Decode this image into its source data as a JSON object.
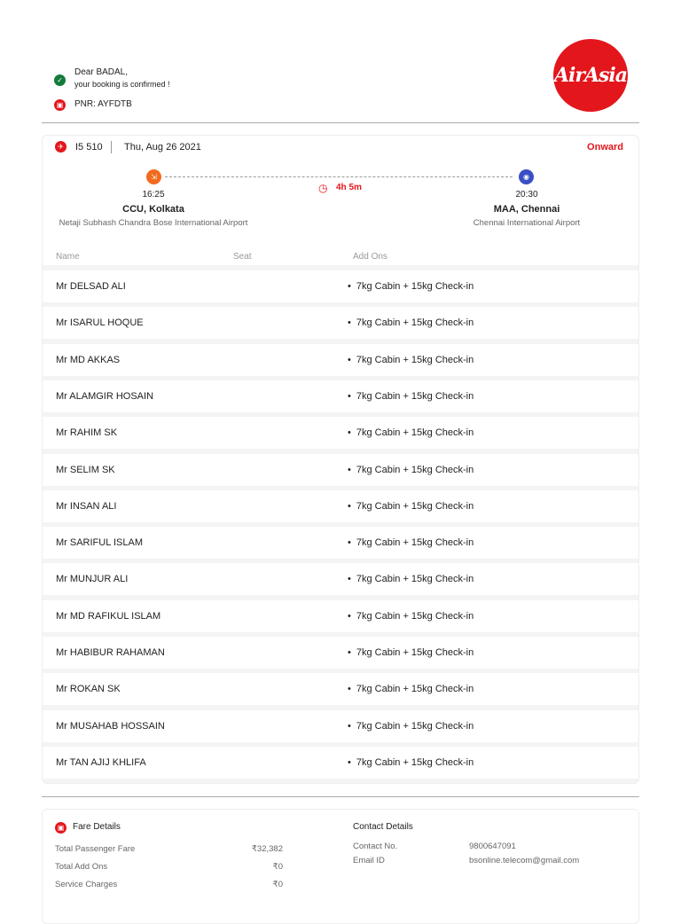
{
  "greeting": {
    "line1": "Dear BADAL,",
    "line2": "your booking is confirmed !",
    "pnr": "PNR: AYFDTB"
  },
  "logo": "AirAsia",
  "flight": {
    "number": "I5 510",
    "date": "Thu, Aug 26 2021",
    "direction": "Onward",
    "duration": "4h 5m",
    "origin": {
      "time": "16:25",
      "code": "CCU, Kolkata",
      "airport": "Netaji Subhash Chandra Bose International Airport"
    },
    "destination": {
      "time": "20:30",
      "code": "MAA, Chennai",
      "airport": "Chennai International Airport"
    }
  },
  "table": {
    "headers": [
      "Name",
      "Seat",
      "Add Ons"
    ],
    "rows": [
      {
        "name": "Mr DELSAD ALI",
        "addon": "7kg Cabin + 15kg Check-in"
      },
      {
        "name": "Mr ISARUL HOQUE",
        "addon": "7kg Cabin + 15kg Check-in"
      },
      {
        "name": "Mr MD AKKAS",
        "addon": "7kg Cabin + 15kg Check-in"
      },
      {
        "name": "Mr ALAMGIR HOSAIN",
        "addon": "7kg Cabin + 15kg Check-in"
      },
      {
        "name": "Mr RAHIM SK",
        "addon": "7kg Cabin + 15kg Check-in"
      },
      {
        "name": "Mr SELIM SK",
        "addon": "7kg Cabin + 15kg Check-in"
      },
      {
        "name": "Mr INSAN ALI",
        "addon": "7kg Cabin + 15kg Check-in"
      },
      {
        "name": "Mr SARIFUL ISLAM",
        "addon": "7kg Cabin + 15kg Check-in"
      },
      {
        "name": "Mr MUNJUR ALI",
        "addon": "7kg Cabin + 15kg Check-in"
      },
      {
        "name": "Mr MD RAFIKUL ISLAM",
        "addon": "7kg Cabin + 15kg Check-in"
      },
      {
        "name": "Mr HABIBUR RAHAMAN",
        "addon": "7kg Cabin + 15kg Check-in"
      },
      {
        "name": "Mr ROKAN SK",
        "addon": "7kg Cabin + 15kg Check-in"
      },
      {
        "name": "Mr MUSAHAB HOSSAIN",
        "addon": "7kg Cabin + 15kg Check-in"
      },
      {
        "name": "Mr TAN AJIJ KHLIFA",
        "addon": "7kg Cabin + 15kg Check-in"
      }
    ]
  },
  "fare": {
    "title": "Fare Details",
    "items": [
      {
        "label": "Total Passenger Fare",
        "value": "₹32,382"
      },
      {
        "label": "Total Add Ons",
        "value": "₹0"
      },
      {
        "label": "Service Charges",
        "value": "₹0"
      }
    ]
  },
  "contact": {
    "title": "Contact Details",
    "items": [
      {
        "label": "Contact No.",
        "value": "9800647091"
      },
      {
        "label": "Email ID",
        "value": "bsonline.telecom@gmail.com"
      }
    ]
  }
}
